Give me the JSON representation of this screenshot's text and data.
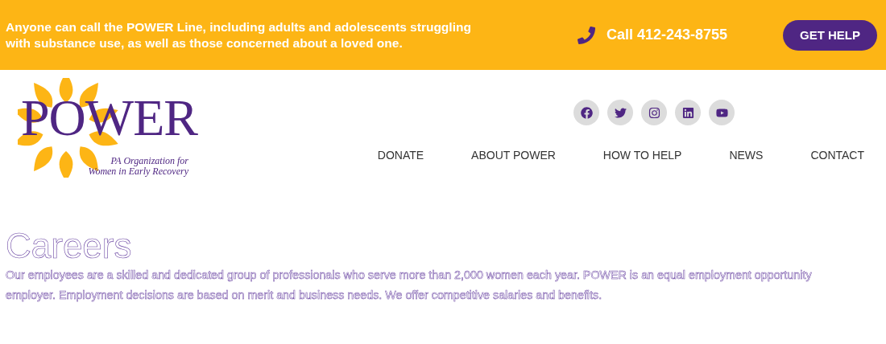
{
  "top_bar": {
    "message": "Anyone can call the POWER Line, including adults and adolescents struggling with substance use, as well as those concerned about a loved one.",
    "phone": "Call 412-243-8755",
    "button": "GET HELP"
  },
  "logo": {
    "name": "POWER",
    "line_1": "PA Organization for",
    "line_2": "Women in Early Recovery"
  },
  "social": [
    {
      "kind": "facebook"
    },
    {
      "kind": "twitter"
    },
    {
      "kind": "instagram"
    },
    {
      "kind": "linkedin"
    },
    {
      "kind": "youtube"
    }
  ],
  "nav": [
    "DONATE",
    "ABOUT POWER",
    "HOW TO HELP",
    "NEWS",
    "CONTACT"
  ],
  "content": {
    "title": "Careers",
    "body": "Our employees are a skilled and dedicated group of professionals who serve more than 2,000 women each year. POWER is an equal employment opportunity employer. Employment decisions are based on merit and business needs. We offer competitive salaries and benefits."
  }
}
